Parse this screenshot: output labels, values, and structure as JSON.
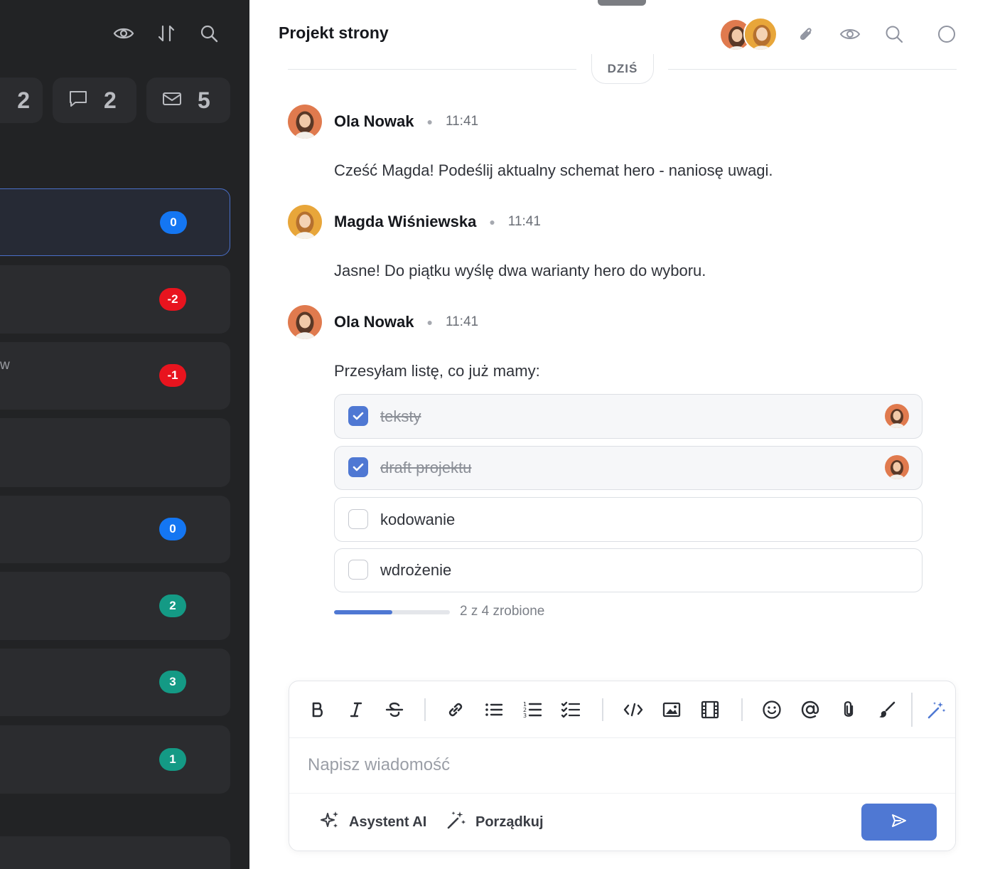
{
  "sidebar": {
    "top_icons": [
      "eye-icon",
      "sort-icon",
      "search-icon"
    ],
    "stats": [
      {
        "icon": "",
        "value": "2"
      },
      {
        "icon": "comment-icon",
        "value": "2"
      },
      {
        "icon": "mail-icon",
        "value": "5"
      }
    ],
    "conversations": [
      {
        "snippet": "",
        "badge": "0",
        "badge_color": "#1476f2",
        "active": true
      },
      {
        "snippet": "",
        "badge": "-2",
        "badge_color": "#e8141e"
      },
      {
        "snippet": "w",
        "badge": "-1",
        "badge_color": "#e8141e"
      },
      {
        "snippet": "",
        "badge": ""
      },
      {
        "snippet": "",
        "badge": "0",
        "badge_color": "#1476f2"
      },
      {
        "snippet": "",
        "badge": "2",
        "badge_color": "#149a85"
      },
      {
        "snippet": "",
        "badge": "3",
        "badge_color": "#149a85"
      },
      {
        "snippet": "",
        "badge": "1",
        "badge_color": "#149a85"
      }
    ]
  },
  "chat": {
    "title": "Projekt strony",
    "header_icons": [
      "paperclip-icon",
      "eye-icon",
      "search-icon",
      "circle-icon"
    ],
    "day_label": "DZIŚ",
    "messages": [
      {
        "author": "Ola Nowak",
        "time": "11:41",
        "text": "Cześć Magda! Podeślij aktualny schemat hero - naniosę uwagi."
      },
      {
        "author": "Magda Wiśniewska",
        "time": "11:41",
        "text": "Jasne! Do piątku wyślę dwa warianty hero do wyboru."
      },
      {
        "author": "Ola Nowak",
        "time": "11:41",
        "text": "Przesyłam listę, co już mamy:"
      }
    ],
    "checklist": {
      "items": [
        {
          "label": "teksty",
          "done": true
        },
        {
          "label": "draft projektu",
          "done": true
        },
        {
          "label": "kodowanie",
          "done": false
        },
        {
          "label": "wdrożenie",
          "done": false
        }
      ],
      "progress": 0.5,
      "progress_label": "2 z 4 zrobione"
    }
  },
  "composer": {
    "toolbar": [
      "bold-icon",
      "italic-icon",
      "strikethrough-icon",
      "link-icon",
      "bullet-list-icon",
      "numbered-list-icon",
      "checklist-icon",
      "code-icon",
      "image-icon",
      "video-icon",
      "emoji-icon",
      "mention-icon",
      "attach-icon",
      "brush-icon",
      "magic-wand-icon"
    ],
    "placeholder": "Napisz wiadomość",
    "ai_assistant_label": "Asystent AI",
    "tidy_label": "Porządkuj"
  },
  "colors": {
    "accent": "#4f78d3",
    "sidebar_bg": "#222325",
    "card_bg": "#2b2c2f"
  }
}
